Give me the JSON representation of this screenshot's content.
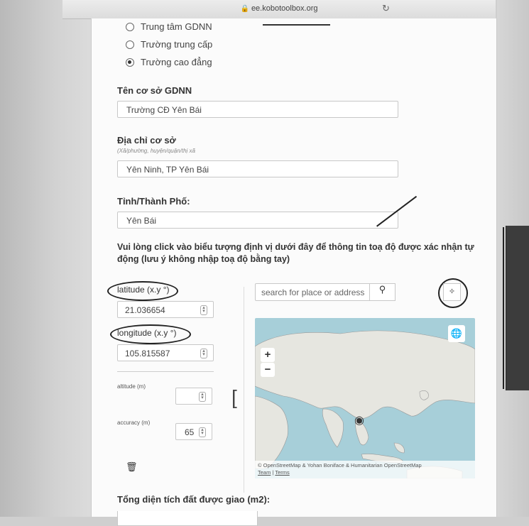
{
  "browser": {
    "url": "ee.kobotoolbox.org"
  },
  "radio_options": [
    {
      "label": "Trung tâm GDNN",
      "checked": false
    },
    {
      "label": "Trường trung cấp",
      "checked": false
    },
    {
      "label": "Trường cao đẳng",
      "checked": true
    }
  ],
  "fields": {
    "ten_co_so": {
      "label": "Tên cơ sở GDNN",
      "value": "Trường CĐ Yên Bái"
    },
    "dia_chi": {
      "label": "Địa chỉ cơ sở",
      "hint": "(Xã/phường, huyện/quận/thị xã",
      "value": "Yên Ninh, TP Yên Bái"
    },
    "tinh": {
      "label": "Tỉnh/Thành Phố:",
      "value": "Yên Bái"
    }
  },
  "geo_question": "Vui lòng click vào biểu tượng định vị dưới đây để thông tin toạ độ được xác nhận tự động (lưu ý không nhập toạ độ bằng tay)",
  "geopoint": {
    "latitude_label": "latitude (x.y °)",
    "latitude_value": "21.036654",
    "longitude_label": "longitude (x.y °)",
    "longitude_value": "105.815587",
    "altitude_label": "altitude (m)",
    "altitude_value": "",
    "accuracy_label": "accuracy (m)",
    "accuracy_value": "65"
  },
  "map": {
    "search_placeholder": "search for place or address",
    "zoom_in": "+",
    "zoom_out": "−",
    "attribution": "© OpenStreetMap & Yohan Boniface & Humanitarian OpenStreetMap",
    "attribution_team": "Team",
    "attribution_terms": "Terms"
  },
  "bottom_label": "Tổng diện tích đất được giao (m2):",
  "icons": {
    "lock": "lock-icon",
    "reload": "reload-icon",
    "search": "search-icon",
    "locate": "crosshair-icon",
    "globe": "globe-icon",
    "marker": "map-marker-icon",
    "trash": "trash-icon"
  }
}
